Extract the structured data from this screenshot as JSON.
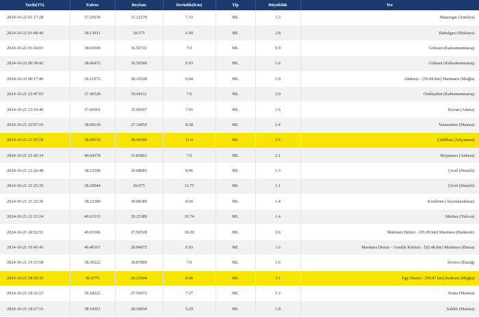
{
  "headers": [
    "Tarih(TS)",
    "Enlem",
    "Boylam",
    "Derinlik(Km)",
    "Tip",
    "Büyüklük",
    "Yer"
  ],
  "highlight_color": "#f7e400",
  "header_color": "#1c3a6e",
  "rows": [
    {
      "date": "2024-10-22 01:17:28",
      "lat": "37.25639",
      "lon": "31.12278",
      "depth": "7.33",
      "type": "ML",
      "mag": "1.3",
      "place": "Manavgat (Antalya)",
      "highlight": false
    },
    {
      "date": "2024-10-22 01:08:40",
      "lat": "38.13611",
      "lon": "38.575",
      "depth": "6.99",
      "type": "ML",
      "mag": "2.8",
      "place": "Battalgazi (Malatya)",
      "highlight": false
    },
    {
      "date": "2024-10-22 01:04:03",
      "lat": "38.04306",
      "lon": "36.50722",
      "depth": "7.0",
      "type": "ML",
      "mag": "0.9",
      "place": "Göksun (Kahramanmaraş)",
      "highlight": false
    },
    {
      "date": "2024-10-22 00:39:42",
      "lat": "38.06472",
      "lon": "36.50306",
      "depth": "6.93",
      "type": "ML",
      "mag": "1.6",
      "place": "Göksun (Kahramanmaraş)",
      "highlight": false
    },
    {
      "date": "2024-10-22 00:17:46",
      "lat": "36.11972",
      "lon": "28.10528",
      "depth": "6.64",
      "type": "ML",
      "mag": "1.9",
      "place": "Akdeniz - [56.84 km] Marmaris (Muğla)",
      "highlight": false
    },
    {
      "date": "2024-10-21 23:47:03",
      "lat": "37.46528",
      "lon": "36.64111",
      "depth": "7.0",
      "type": "ML",
      "mag": "2.0",
      "place": "Onikişubat (Kahramanmaraş)",
      "highlight": false
    },
    {
      "date": "2024-10-21 23:16:40",
      "lat": "37.60361",
      "lon": "35.96667",
      "depth": "7.01",
      "type": "ML",
      "mag": "1.6",
      "place": "Kozan (Adana)",
      "highlight": false
    },
    {
      "date": "2024-10-21 22:07:10",
      "lat": "38.68139",
      "lon": "27.34056",
      "depth": "8.28",
      "type": "ML",
      "mag": "2.4",
      "place": "Yunusemre (Manisa)",
      "highlight": false
    },
    {
      "date": "2024-10-21 21:55:18",
      "lat": "38.08139",
      "lon": "38.40306",
      "depth": "11.4",
      "type": "ML",
      "mag": "3.5",
      "place": "Çelikhan (Adıyaman)",
      "highlight": true
    },
    {
      "date": "2024-10-21 21:45:34",
      "lat": "40.04278",
      "lon": "31.83861",
      "depth": "7.0",
      "type": "ML",
      "mag": "2.1",
      "place": "Beypazarı (Ankara)",
      "highlight": false
    },
    {
      "date": "2024-10-21 21:26:48",
      "lat": "38.22306",
      "lon": "30.08083",
      "depth": "8.96",
      "type": "ML",
      "mag": "1.3",
      "place": "Çivril (Denizli)",
      "highlight": false
    },
    {
      "date": "2024-10-21 21:25:35",
      "lat": "38.20944",
      "lon": "30.075",
      "depth": "11.75",
      "type": "ML",
      "mag": "1.1",
      "place": "Çivril (Denizli)",
      "highlight": false
    },
    {
      "date": "2024-10-21 21:22:36",
      "lat": "38.22389",
      "lon": "30.08389",
      "depth": "8.56",
      "type": "ML",
      "mag": "1.4",
      "place": "Kızılören (Afyonkarahisar)",
      "highlight": false
    },
    {
      "date": "2024-10-21 21:15:24",
      "lat": "40.63333",
      "lon": "29.25389",
      "depth": "10.74",
      "type": "ML",
      "mag": "1.4",
      "place": "Merkez (Yalova)",
      "highlight": false
    },
    {
      "date": "2024-10-21 20:52:51",
      "lat": "40.65306",
      "lon": "27.50528",
      "depth": "18.29",
      "type": "ML",
      "mag": "2.6",
      "place": "Marmara Denizi - [05.08 km] Marmara (Balıkesir)",
      "highlight": false
    },
    {
      "date": "2024-10-21 19:45:43",
      "lat": "40.40167",
      "lon": "28.84972",
      "depth": "6.93",
      "type": "ML",
      "mag": "1.6",
      "place": "Marmara Denizi - Gemlik Körfezi - [02.48 km] Mudanya (Bursa)",
      "highlight": false
    },
    {
      "date": "2024-10-21 19:33:58",
      "lat": "38.39222",
      "lon": "38.87889",
      "depth": "7.0",
      "type": "ML",
      "mag": "1.6",
      "place": "Sivrice (Elazığ)",
      "highlight": false
    },
    {
      "date": "2024-10-21 18:59:35",
      "lat": "36.6775",
      "lon": "26.21694",
      "depth": "8.96",
      "type": "ML",
      "mag": "3.1",
      "place": "Ege Denizi - [99.87 km] Bodrum (Muğla)",
      "highlight": true
    },
    {
      "date": "2024-10-21 18:32:15",
      "lat": "39.18222",
      "lon": "27.56972",
      "depth": "7.27",
      "type": "ML",
      "mag": "1.3",
      "place": "Soma (Manisa)",
      "highlight": false
    },
    {
      "date": "2024-10-21 18:27:16",
      "lat": "38.54361",
      "lon": "28.18694",
      "depth": "5.29",
      "type": "ML",
      "mag": "1.8",
      "place": "Salihli (Manisa)",
      "highlight": false
    }
  ]
}
